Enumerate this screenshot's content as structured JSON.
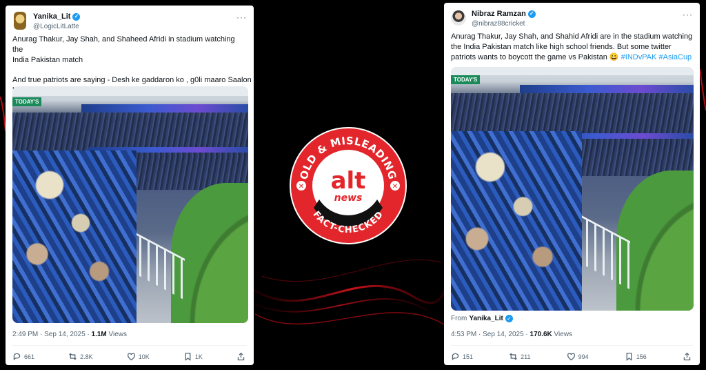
{
  "left_tweet": {
    "name": "Yanika_Lit",
    "handle": "@LogicLitLatte",
    "text_line1": "Anurag Thakur, Jay Shah, and Shaheed Afridi in stadium watching the",
    "text_line2": "India Pakistan match",
    "text_line3": "And true patriots are saying -   Desh ke gaddaron ko ,  g0li maaro Saalon",
    "text_line4": "ko",
    "media_banner": "TODAY'S",
    "time": "2:49 PM · Sep 14, 2025 · ",
    "views_count": "1.1M",
    "views_label": " Views",
    "replies": "661",
    "reposts": "2.8K",
    "likes": "10K",
    "bookmarks": "1K"
  },
  "right_tweet": {
    "name": "Nibraz Ramzan",
    "handle": "@nibraz88cricket",
    "text_line1": "Anurag Thakur, Jay Shah, and Shahid Afridi are in the stadium watching",
    "text_line2": "the India Pakistan match like high school friends. But some twitter",
    "text_line3": "patriots wants to boycott the game vs Pakistan 😀 ",
    "hashtag1": "#INDvPAK",
    "hashtag2": "#AsiaCup",
    "media_banner": "TODAY'S",
    "from_label": "From ",
    "from_name": "Yanika_Lit",
    "time": "4:53 PM · Sep 14, 2025 · ",
    "views_count": "170.6K",
    "views_label": " Views",
    "replies": "151",
    "reposts": "211",
    "likes": "994",
    "bookmarks": "156"
  },
  "badge": {
    "top_text": "OLD & MISLEADING",
    "logo_top": "alt",
    "logo_bottom": "news",
    "bottom_text": "FACT-CHECKED"
  },
  "colors": {
    "accent_blue": "#1d9bf0",
    "badge_red": "#e3262b",
    "swoosh_red": "#c8101a"
  }
}
